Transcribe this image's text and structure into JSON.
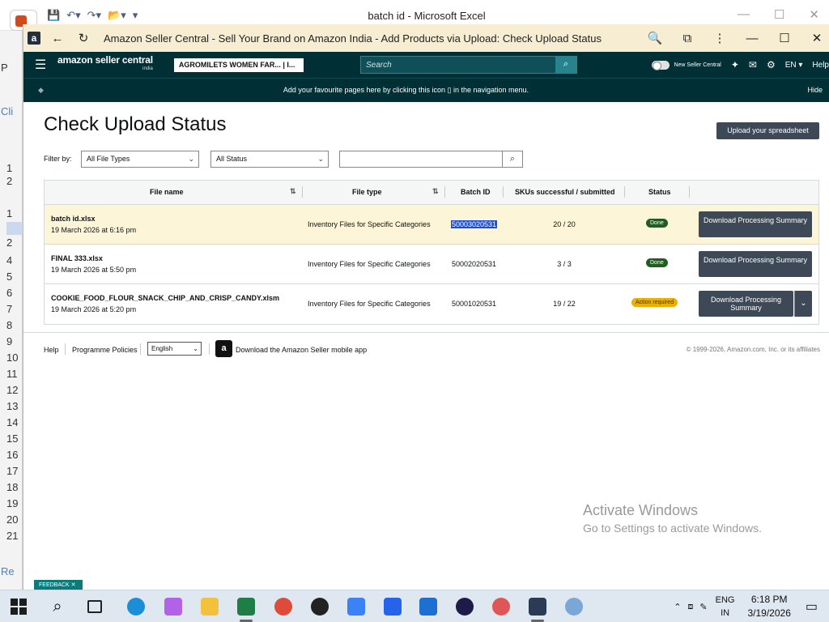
{
  "excel": {
    "window_title": "batch id - Microsoft Excel",
    "row_numbers": [
      "1",
      "2",
      "1",
      "2",
      "4",
      "5",
      "6",
      "7",
      "8",
      "9",
      "10",
      "11",
      "12",
      "13",
      "14",
      "15",
      "16",
      "17",
      "18",
      "19",
      "20",
      "21"
    ],
    "side_text": [
      "P",
      "Cli",
      "Re"
    ]
  },
  "browser": {
    "title": "Amazon Seller Central - Sell Your Brand on Amazon India - Add Products via Upload: Check Upload Status",
    "app_badge": "a"
  },
  "nav": {
    "logo_main": "amazon seller central",
    "logo_sub": "india",
    "store_selector": "AGROMILETS WOMEN FAR... | I...",
    "search_placeholder": "Search",
    "new_seller_central": "New Seller Central",
    "language": "EN",
    "help": "Help"
  },
  "favbar": {
    "message": "Add your favourite pages here by clicking this icon ▯ in the navigation menu.",
    "hide": "Hide"
  },
  "page": {
    "title": "Check Upload Status",
    "upload_button": "Upload your spreadsheet",
    "filter_label": "Filter by:",
    "file_type_select": "All File Types",
    "status_select": "All Status",
    "search_value": ""
  },
  "table": {
    "headers": {
      "file_name": "File name",
      "file_type": "File type",
      "batch_id": "Batch ID",
      "skus": "SKUs successful / submitted",
      "status": "Status"
    },
    "rows": [
      {
        "file_name": "batch id.xlsx",
        "date": "19 March 2026 at 6:16 pm",
        "file_type": "Inventory Files for Specific Categories",
        "batch_id": "50003020531",
        "skus": "20 / 20",
        "status": "Done",
        "action": "Download Processing Summary"
      },
      {
        "file_name": "FINAL 333.xlsx",
        "date": "19 March 2026 at 5:50 pm",
        "file_type": "Inventory Files for Specific Categories",
        "batch_id": "50002020531",
        "skus": "3 / 3",
        "status": "Done",
        "action": "Download Processing Summary"
      },
      {
        "file_name": "COOKIE_FOOD_FLOUR_SNACK_CHIP_AND_CRISP_CANDY.xlsm",
        "date": "19 March 2026 at 5:20 pm",
        "file_type": "Inventory Files for Specific Categories",
        "batch_id": "50001020531",
        "skus": "19 / 22",
        "status": "Action required",
        "action": "Download Processing Summary"
      }
    ]
  },
  "footer": {
    "help": "Help",
    "policies": "Programme Policies",
    "language": "English",
    "app_text": "Download the Amazon Seller mobile app",
    "copyright": "© 1999-2026, Amazon.com, Inc. or its affiliates"
  },
  "watermark": {
    "line1": "Activate Windows",
    "line2": "Go to Settings to activate Windows."
  },
  "feedback": "FEEDBACK",
  "taskbar": {
    "lang1": "ENG",
    "lang2": "IN",
    "time": "6:18 PM",
    "date": "3/19/2026"
  },
  "colors": {
    "nav_bg": "#002f36",
    "button_bg": "#3d4957",
    "status_done": "#1f5d20",
    "status_action": "#e9b000",
    "highlight_row": "#fcf5d8",
    "selection": "#1d4ed8"
  }
}
